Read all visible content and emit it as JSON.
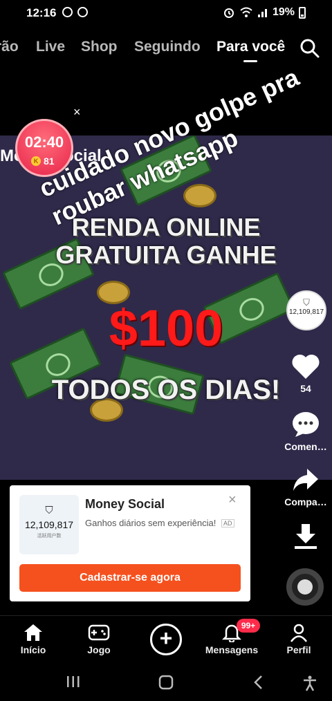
{
  "status_bar": {
    "time": "12:16",
    "battery": "19%"
  },
  "top_tabs": [
    {
      "label": "rão",
      "active": false
    },
    {
      "label": "Live",
      "active": false
    },
    {
      "label": "Shop",
      "active": false
    },
    {
      "label": "Seguindo",
      "active": false
    },
    {
      "label": "Para você",
      "active": true
    }
  ],
  "video": {
    "brand_text": "MoneySocial",
    "headline_1": "RENDA ONLINE",
    "headline_2": "GRATUITA GANHE",
    "amount": "$100",
    "headline_3": "TODOS OS DIAS!",
    "overlay_caption": "cuidado novo golpe pra roubar whatsapp",
    "close_label": "×"
  },
  "timer": {
    "time": "02:40",
    "coins": "81",
    "coin_symbol": "K"
  },
  "actions": {
    "avatar_text": "12,109,817",
    "likes": "54",
    "comments_label": "Comen…",
    "share_label": "Compa…"
  },
  "ad": {
    "thumb_count": "12,109,817",
    "thumb_sub": "活跃用户数",
    "title": "Money Social",
    "description": "Ganhos diários sem experiência!",
    "tag": "AD",
    "close_label": "×",
    "cta": "Cadastrar-se agora"
  },
  "bottom_nav": {
    "home": "Início",
    "game": "Jogo",
    "messages": "Mensagens",
    "messages_badge": "99+",
    "profile": "Perfil"
  },
  "colors": {
    "accent": "#f5511e",
    "badge": "#ff2b4a",
    "amount": "#ff1a1a"
  }
}
